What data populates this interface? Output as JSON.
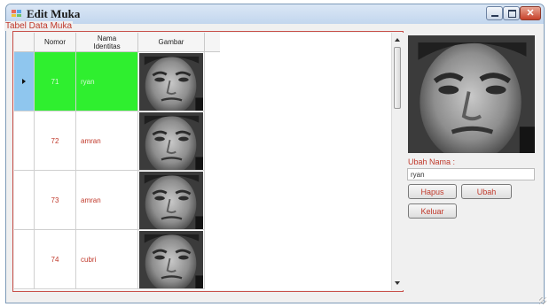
{
  "window": {
    "title": "Edit Muka"
  },
  "group": {
    "legend": "Tabel Data Muka"
  },
  "table": {
    "columns": [
      "Nomor",
      "Nama\nIdentitas",
      "Gambar"
    ],
    "rows": [
      {
        "nomor": "71",
        "nama": "ryan",
        "gambar": "face-image",
        "selected": true
      },
      {
        "nomor": "72",
        "nama": "amran",
        "gambar": "face-image",
        "selected": false
      },
      {
        "nomor": "73",
        "nama": "amran",
        "gambar": "face-image",
        "selected": false
      },
      {
        "nomor": "74",
        "nama": "cubri",
        "gambar": "face-image",
        "selected": false
      }
    ],
    "selection_color": "#2fef2f"
  },
  "editor": {
    "label": "Ubah Nama :",
    "name_value": "ryan",
    "buttons": {
      "hapus": "Hapus",
      "ubah": "Ubah",
      "keluar": "Keluar"
    }
  },
  "colors": {
    "accent_text": "#c0392b",
    "selected_row": "#2fef2f",
    "row_header_selected": "#8fc6ee"
  }
}
